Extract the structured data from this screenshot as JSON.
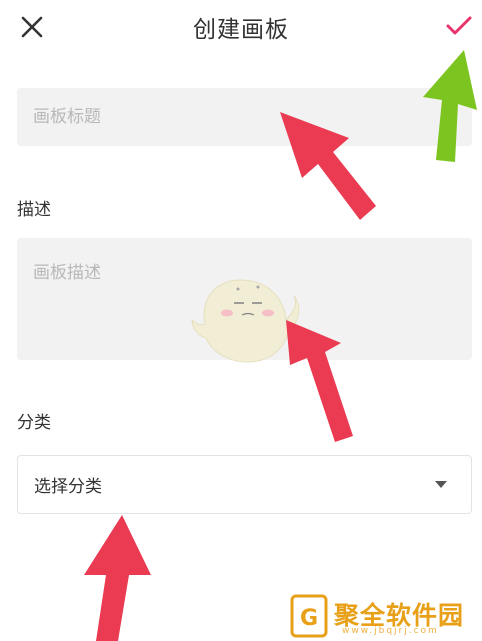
{
  "header": {
    "title": "创建画板",
    "close_icon": "close-icon",
    "confirm_icon": "checkmark-icon",
    "accent_color": "#e8336b"
  },
  "form": {
    "title_placeholder": "画板标题",
    "description_label": "描述",
    "description_placeholder": "画板描述",
    "category_label": "分类",
    "category_select_text": "选择分类"
  },
  "annotations": {
    "red_arrow_color": "#ea3b52",
    "green_arrow_color": "#7cc520"
  },
  "watermark": {
    "text": "聚全软件园",
    "url": "www.jbqjrj.com",
    "badge_letter": "G",
    "color": "#e8a018"
  }
}
